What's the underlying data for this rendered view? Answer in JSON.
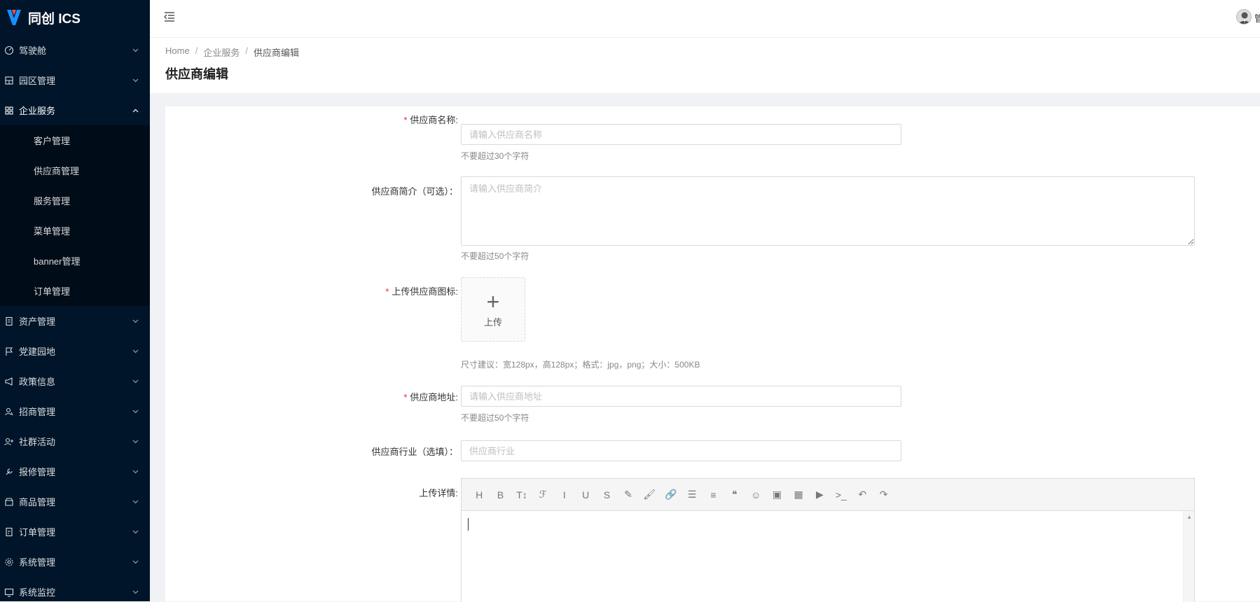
{
  "app": {
    "name": "同创 ICS"
  },
  "sidebar": {
    "items": [
      {
        "label": "驾驶舱",
        "icon": "dashboard-icon"
      },
      {
        "label": "园区管理",
        "icon": "building-icon"
      },
      {
        "label": "企业服务",
        "icon": "grid-icon"
      },
      {
        "label": "资产管理",
        "icon": "asset-icon"
      },
      {
        "label": "党建园地",
        "icon": "flag-icon"
      },
      {
        "label": "政策信息",
        "icon": "megaphone-icon"
      },
      {
        "label": "招商管理",
        "icon": "user-group-icon"
      },
      {
        "label": "社群活动",
        "icon": "community-icon"
      },
      {
        "label": "报修管理",
        "icon": "wrench-icon"
      },
      {
        "label": "商品管理",
        "icon": "shop-icon"
      },
      {
        "label": "订单管理",
        "icon": "order-icon"
      },
      {
        "label": "系统管理",
        "icon": "gear-icon"
      },
      {
        "label": "系统监控",
        "icon": "monitor-icon"
      }
    ],
    "submenu": [
      {
        "label": "客户管理"
      },
      {
        "label": "供应商管理"
      },
      {
        "label": "服务管理"
      },
      {
        "label": "菜单管理"
      },
      {
        "label": "banner管理"
      },
      {
        "label": "订单管理"
      }
    ]
  },
  "header": {
    "user_name": "管"
  },
  "breadcrumb": {
    "home": "Home",
    "parent": "企业服务",
    "current": "供应商编辑",
    "sep": "/"
  },
  "page": {
    "title": "供应商编辑"
  },
  "form": {
    "name": {
      "label": "供应商名称:",
      "placeholder": "请输入供应商名称",
      "hint": "不要超过30个字符",
      "required": "*"
    },
    "intro": {
      "label": "供应商简介（可选）：",
      "placeholder": "请输入供应商简介",
      "hint": "不要超过50个字符"
    },
    "icon": {
      "label": "上传供应商图标:",
      "required": "*",
      "plus": "+",
      "upload_text": "上传",
      "hint": "尺寸建议：宽128px，高128px；格式：jpg，png；大小：500KB"
    },
    "address": {
      "label": "供应商地址:",
      "placeholder": "请输入供应商地址",
      "hint": "不要超过50个字符",
      "required": "*"
    },
    "industry": {
      "label": "供应商行业（选填）：",
      "placeholder": "供应商行业"
    },
    "detail": {
      "label": "上传详情:"
    }
  },
  "toolbar": {
    "buttons": [
      {
        "glyph": "H",
        "icon": "heading-icon"
      },
      {
        "glyph": "B",
        "icon": "bold-icon"
      },
      {
        "glyph": "T↕",
        "icon": "font-size-icon"
      },
      {
        "glyph": "ℱ",
        "icon": "font-family-icon"
      },
      {
        "glyph": "I",
        "icon": "italic-icon"
      },
      {
        "glyph": "U",
        "icon": "underline-icon"
      },
      {
        "glyph": "S",
        "icon": "strikethrough-icon"
      },
      {
        "glyph": "✎",
        "icon": "text-color-icon"
      },
      {
        "glyph": "🖌",
        "icon": "background-color-icon"
      },
      {
        "glyph": "🔗",
        "icon": "link-icon"
      },
      {
        "glyph": "☰",
        "icon": "list-icon"
      },
      {
        "glyph": "≡",
        "icon": "align-icon"
      },
      {
        "glyph": "❝",
        "icon": "quote-icon"
      },
      {
        "glyph": "☺",
        "icon": "emoji-icon"
      },
      {
        "glyph": "▣",
        "icon": "image-icon"
      },
      {
        "glyph": "▦",
        "icon": "table-icon"
      },
      {
        "glyph": "▶",
        "icon": "video-icon"
      },
      {
        "glyph": ">_",
        "icon": "code-icon"
      },
      {
        "glyph": "↶",
        "icon": "undo-icon"
      },
      {
        "glyph": "↷",
        "icon": "redo-icon"
      }
    ]
  },
  "colors": {
    "sidebar_bg": "#001529",
    "submenu_bg": "#000c17",
    "required": "#f5222d"
  }
}
